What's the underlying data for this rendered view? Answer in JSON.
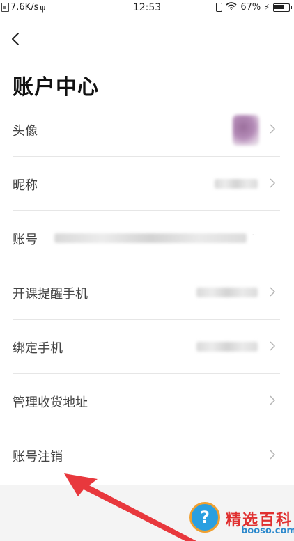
{
  "status_bar": {
    "net_speed": "7.6K/s",
    "time": "12:53",
    "battery": "67%"
  },
  "header": {
    "back_icon": "chevron-left-icon",
    "title": "账户中心"
  },
  "rows": [
    {
      "label": "头像"
    },
    {
      "label": "昵称"
    },
    {
      "label": "账号"
    },
    {
      "label": "开课提醒手机"
    },
    {
      "label": "绑定手机"
    },
    {
      "label": "管理收货地址"
    },
    {
      "label": "账号注销"
    }
  ],
  "account_suffix": "··",
  "annotation": {
    "arrow_color": "#e8383d"
  },
  "watermark": {
    "badge": "?",
    "text": "精选百科",
    "site": "booso.com"
  }
}
